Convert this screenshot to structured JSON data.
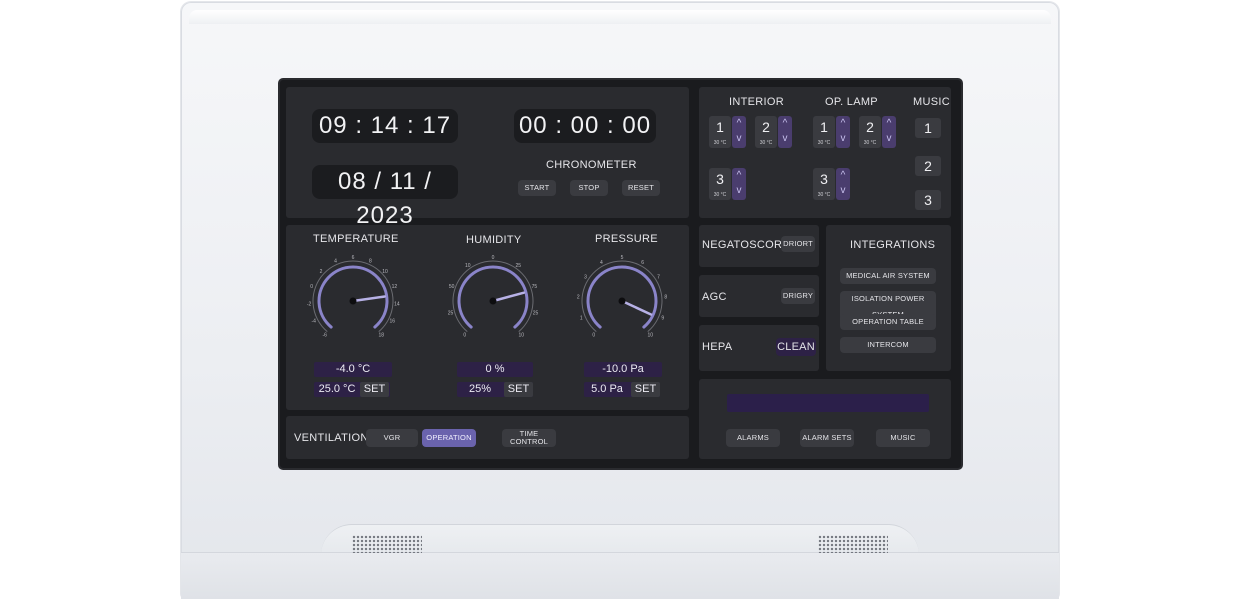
{
  "clock": {
    "time": "09 : 14 : 17",
    "date": "08 / 11 / 2023"
  },
  "chronometer": {
    "display": "00 : 00 : 00",
    "label": "CHRONOMETER",
    "buttons": [
      "START",
      "STOP",
      "RESET"
    ]
  },
  "lamps": {
    "interior": {
      "title": "INTERIOR",
      "tiles": [
        {
          "num": "1",
          "temp": "30 °C"
        },
        {
          "num": "2",
          "temp": "30 °C"
        },
        {
          "num": "3",
          "temp": "30 °C"
        }
      ]
    },
    "op_lamp": {
      "title": "OP. LAMP",
      "tiles": [
        {
          "num": "1",
          "temp": "30 °C"
        },
        {
          "num": "2",
          "temp": "30 °C"
        },
        {
          "num": "3",
          "temp": "30 °C"
        }
      ]
    },
    "music": {
      "title": "MUSIC",
      "buttons": [
        "1",
        "2",
        "3"
      ]
    },
    "arrow_up": "^",
    "arrow_down": "v"
  },
  "gauges": [
    {
      "title": "TEMPERATURE",
      "current": "-4.0 °C",
      "setpoint": "25.0 °C",
      "set_label": "SET",
      "ticks": [
        "-6",
        "-4",
        "-2",
        "0",
        "2",
        "4",
        "6",
        "8",
        "10",
        "12",
        "14",
        "16",
        "18"
      ]
    },
    {
      "title": "HUMIDITY",
      "current": "0 %",
      "setpoint": "25%",
      "set_label": "SET",
      "ticks": [
        "0",
        "25",
        "50",
        "10",
        "0",
        "25",
        "75",
        "25",
        "10"
      ]
    },
    {
      "title": "PRESSURE",
      "current": "-10.0 Pa",
      "setpoint": "5.0 Pa",
      "set_label": "SET",
      "ticks": [
        "0",
        "1",
        "2",
        "3",
        "4",
        "5",
        "6",
        "7",
        "8",
        "9",
        "10"
      ]
    }
  ],
  "ventilation": {
    "label": "VENTILATION",
    "buttons": [
      "VGR",
      "OPERATION",
      "TIME CONTROL"
    ],
    "active": "OPERATION"
  },
  "controls": [
    {
      "label": "NEGATOSCORE",
      "button": "DRIORT"
    },
    {
      "label": "AGC",
      "button": "DRIGRY"
    },
    {
      "label": "HEPA",
      "button": "CLEAN"
    }
  ],
  "integrations": {
    "title": "INTEGRATIONS",
    "buttons": [
      "MEDICAL AIR SYSTEM",
      "ISOLATION POWER SYSTEM",
      "OPERATION TABLE",
      "INTERCOM"
    ]
  },
  "alarm_panel": {
    "buttons": [
      "ALARMS",
      "ALARM SETS",
      "MUSIC"
    ]
  },
  "colors": {
    "accent": "#6a63ad",
    "needle": "#b7b1e6",
    "panel": "#2a2b2f",
    "screen": "#1a1b1e"
  }
}
